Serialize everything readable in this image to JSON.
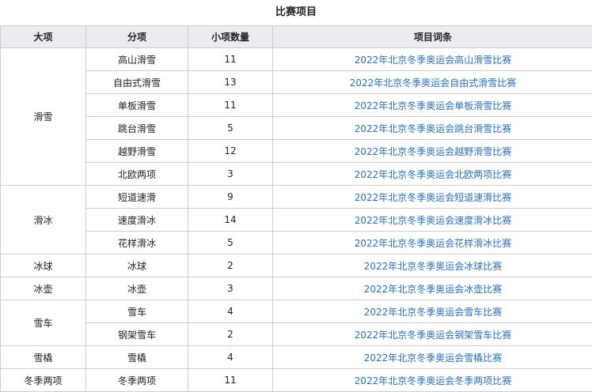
{
  "caption": "比赛项目",
  "headers": {
    "category": "大项",
    "discipline": "分项",
    "count": "小项数量",
    "entry": "项目词条"
  },
  "categories": {
    "skiing": "滑雪",
    "skating": "滑冰",
    "icehockey": "冰球",
    "curling": "冰壶",
    "bobsleigh": "雪车",
    "luge": "雪橇",
    "biathlon": "冬季两项"
  },
  "rows": [
    {
      "discipline": "高山滑雪",
      "count": "11",
      "entry": "2022年北京冬季奥运会高山滑雪比赛"
    },
    {
      "discipline": "自由式滑雪",
      "count": "13",
      "entry": "2022年北京冬季奥运会自由式滑雪比赛"
    },
    {
      "discipline": "单板滑雪",
      "count": "11",
      "entry": "2022年北京冬季奥运会单板滑雪比赛"
    },
    {
      "discipline": "跳台滑雪",
      "count": "5",
      "entry": "2022年北京冬季奥运会跳台滑雪比赛"
    },
    {
      "discipline": "越野滑雪",
      "count": "12",
      "entry": "2022年北京冬季奥运会越野滑雪比赛"
    },
    {
      "discipline": "北欧两项",
      "count": "3",
      "entry": "2022年北京冬季奥运会北欧两项比赛"
    },
    {
      "discipline": "短道速滑",
      "count": "9",
      "entry": "2022年北京冬季奥运会短道速滑比赛"
    },
    {
      "discipline": "速度滑冰",
      "count": "14",
      "entry": "2022年北京冬季奥运会速度滑冰比赛"
    },
    {
      "discipline": "花样滑冰",
      "count": "5",
      "entry": "2022年北京冬季奥运会花样滑冰比赛"
    },
    {
      "discipline": "冰球",
      "count": "2",
      "entry": "2022年北京冬季奥运会冰球比赛"
    },
    {
      "discipline": "冰壶",
      "count": "3",
      "entry": "2022年北京冬季奥运会冰壶比赛"
    },
    {
      "discipline": "雪车",
      "count": "4",
      "entry": "2022年北京冬季奥运会雪车比赛"
    },
    {
      "discipline": "钢架雪车",
      "count": "2",
      "entry": "2022年北京冬季奥运会钢架雪车比赛"
    },
    {
      "discipline": "雪橇",
      "count": "4",
      "entry": "2022年北京冬季奥运会雪橇比赛"
    },
    {
      "discipline": "冬季两项",
      "count": "11",
      "entry": "2022年北京冬季奥运会冬季两项比赛"
    }
  ],
  "colors": {
    "header_bg": "#eaecf0",
    "border": "#c8ccd1",
    "link": "#2a6fb5"
  }
}
